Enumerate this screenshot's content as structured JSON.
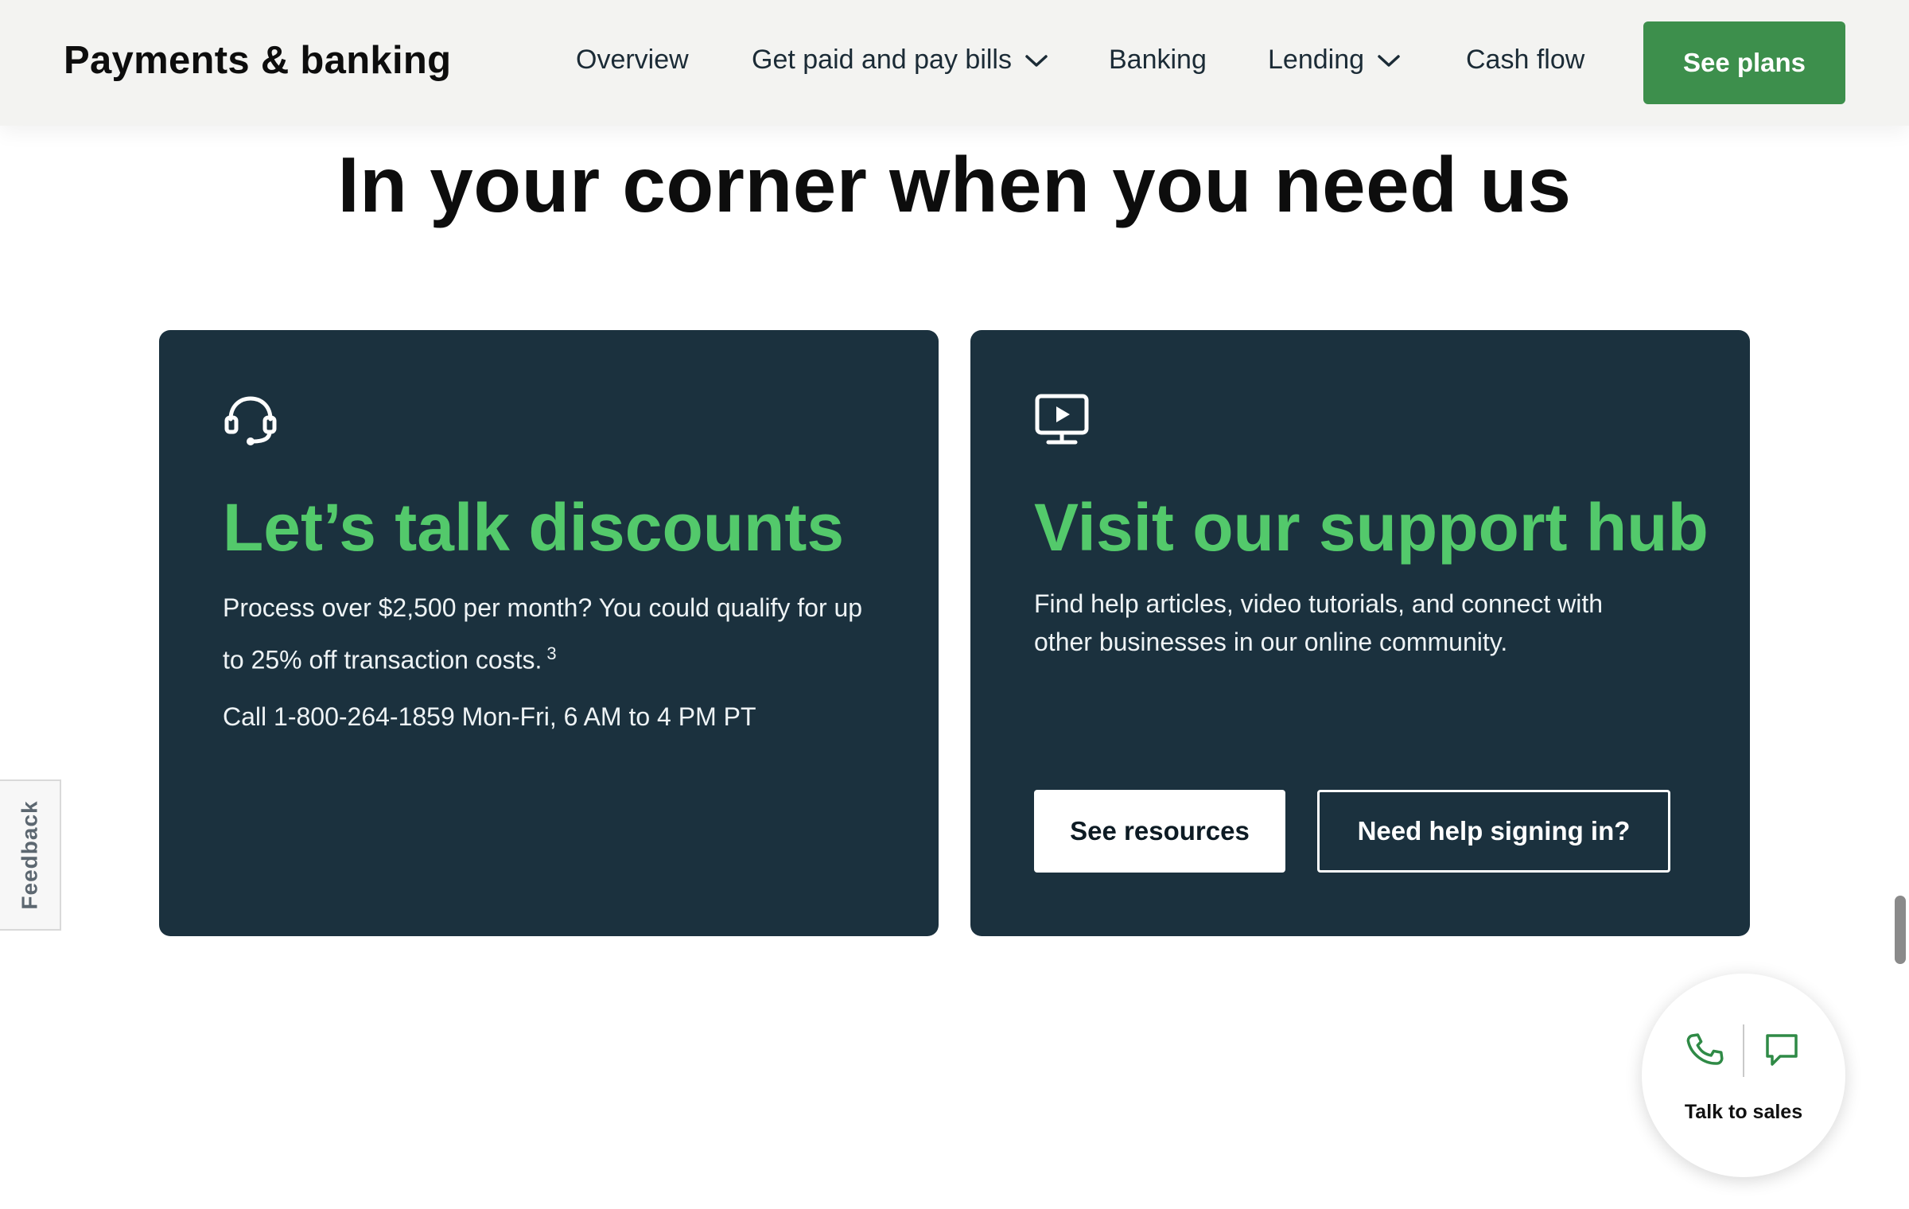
{
  "header": {
    "brand": "Payments & banking",
    "nav": [
      {
        "label": "Overview"
      },
      {
        "label": "Get paid and pay bills"
      },
      {
        "label": "Banking"
      },
      {
        "label": "Lending"
      },
      {
        "label": "Cash flow"
      }
    ],
    "cta_label": "See plans"
  },
  "headline": "In your corner when you need us",
  "cards": {
    "discounts": {
      "icon": "headset-icon",
      "title": "Let’s talk discounts",
      "body": "Process over $2,500 per month? You could qualify for up to 25% off transaction costs.",
      "footnote": "3",
      "call": "Call 1-800-264-1859 Mon-Fri, 6 AM to 4 PM PT"
    },
    "support": {
      "icon": "video-monitor-icon",
      "title": "Visit our support hub",
      "body": "Find help articles, video tutorials, and connect with other businesses in our online community.",
      "primary_button": "See resources",
      "secondary_button": "Need help signing in?"
    }
  },
  "feedback_tab": "Feedback",
  "talk_to_sales": {
    "label": "Talk to sales",
    "icons": [
      "phone-icon",
      "chat-icon"
    ]
  },
  "colors": {
    "brand_green": "#3d8f4c",
    "title_green": "#53c96b",
    "card_bg": "#1b313e",
    "header_bg": "#f3f3f1"
  }
}
